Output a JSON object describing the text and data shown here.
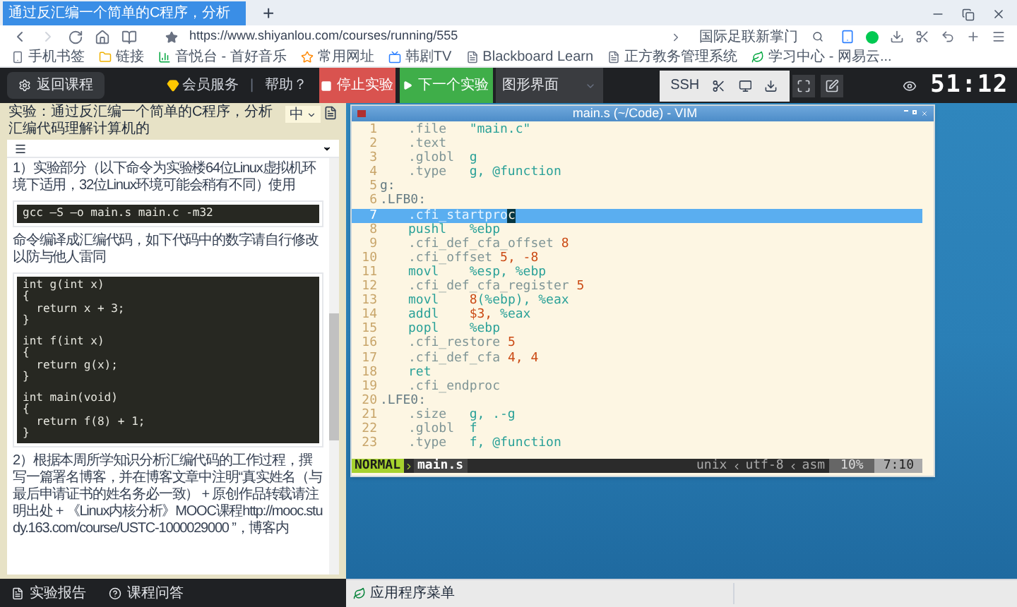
{
  "browser": {
    "tab": {
      "title": "通过反汇编一个简单的C程序，分析",
      "selected": true
    },
    "new_tab": "+",
    "url": "https://www.shiyanlou.com/courses/running/555",
    "search": {
      "value": "国际足联新掌门"
    },
    "bookmarks": [
      {
        "label": "手机书签",
        "kind": "phone"
      },
      {
        "label": "链接",
        "kind": "folder"
      },
      {
        "label": "音悦台 - 首好音乐",
        "kind": "chart"
      },
      {
        "label": "常用网址",
        "kind": "star"
      },
      {
        "label": "韩剧TV",
        "kind": "tv"
      },
      {
        "label": "Blackboard Learn",
        "kind": "page"
      },
      {
        "label": "正方教务管理系统",
        "kind": "page"
      },
      {
        "label": "学习中心 - 网易云...",
        "kind": "leaf"
      }
    ]
  },
  "toolbar": {
    "back": "返回课程",
    "member": "会员服务",
    "separator": "|",
    "help": "帮助？",
    "stop": "停止实验",
    "next": "下一个实验",
    "view_select": "图形界面",
    "ssh": "SSH",
    "timer": "51:12"
  },
  "lab": {
    "title": "实验：通过反汇编一个简单的C程序，分析汇编代码理解计算机的",
    "language": "中",
    "content": [
      {
        "kind": "text",
        "text": "1）实验部分（以下命令为实验楼64位Linux虚拟机环境下适用，32位Linux环境可能会稍有不同）使用"
      },
      {
        "kind": "code",
        "blocks": [
          [
            "gcc –S –o main.s main.c -m32"
          ]
        ]
      },
      {
        "kind": "text",
        "text": "命令编译成汇编代码，如下代码中的数字请自行修改以防与他人雷同"
      },
      {
        "kind": "code",
        "blocks": [
          [
            "int g(int x)",
            "{",
            "  return x + 3;",
            "}"
          ],
          [
            "int f(int x)",
            "{",
            "  return g(x);",
            "}"
          ],
          [
            "int main(void)",
            "{",
            "  return f(8) + 1;",
            "}"
          ]
        ]
      },
      {
        "kind": "text",
        "text": "2）根据本周所学知识分析汇编代码的工作过程，撰写一篇署名博客，并在博客文章中注明“真实姓名（与最后申请证书的姓名务必一致） + 原创作品转载请注明出处 + 《Linux内核分析》MOOC课程http://mooc.study.163.com/course/USTC-1000029000 ”，博客内"
      }
    ],
    "footer": [
      {
        "label": "实验报告",
        "kind": "report"
      },
      {
        "label": "课程问答",
        "kind": "question"
      }
    ]
  },
  "vim": {
    "title": "main.s (~/Code) - VIM",
    "lines": [
      {
        "number": "1",
        "indented": true,
        "selected": false,
        "tokens": [
          {
            "text": ".file",
            "kind": "dir"
          },
          {
            "text": "\"main.c\"",
            "kind": "str"
          }
        ]
      },
      {
        "number": "2",
        "indented": true,
        "selected": false,
        "tokens": [
          {
            "text": ".text",
            "kind": "dir"
          }
        ]
      },
      {
        "number": "3",
        "indented": true,
        "selected": false,
        "tokens": [
          {
            "text": ".globl",
            "kind": "dir"
          },
          {
            "text": "g",
            "kind": "op"
          }
        ]
      },
      {
        "number": "4",
        "indented": true,
        "selected": false,
        "tokens": [
          {
            "text": ".type",
            "kind": "dir"
          },
          {
            "text": "g, @function",
            "kind": "op"
          }
        ]
      },
      {
        "number": "5",
        "indented": false,
        "selected": false,
        "tokens": [
          {
            "text": "g:",
            "kind": "lbl"
          }
        ]
      },
      {
        "number": "6",
        "indented": false,
        "selected": false,
        "tokens": [
          {
            "text": ".LFB0:",
            "kind": "lbl"
          }
        ]
      },
      {
        "number": "7",
        "indented": true,
        "selected": true,
        "tokens": [
          {
            "text": ".cfi_startpro",
            "kind": "dir"
          },
          {
            "text": "c",
            "kind": "cursor"
          }
        ]
      },
      {
        "number": "8",
        "indented": true,
        "selected": false,
        "tokens": [
          {
            "text": "pushl",
            "kind": "instr"
          },
          {
            "text": "%ebp",
            "kind": "op"
          }
        ]
      },
      {
        "number": "9",
        "indented": true,
        "selected": false,
        "tokens": [
          {
            "text": ".cfi_def_cfa_offset",
            "kind": "dir"
          },
          {
            "text": "8",
            "kind": "num"
          }
        ]
      },
      {
        "number": "10",
        "indented": true,
        "selected": false,
        "tokens": [
          {
            "text": ".cfi_offset",
            "kind": "dir"
          },
          {
            "text": "5, -8",
            "kind": "num"
          }
        ]
      },
      {
        "number": "11",
        "indented": true,
        "selected": false,
        "tokens": [
          {
            "text": "movl",
            "kind": "instr"
          },
          {
            "text": "%esp, %ebp",
            "kind": "op"
          }
        ]
      },
      {
        "number": "12",
        "indented": true,
        "selected": false,
        "tokens": [
          {
            "text": ".cfi_def_cfa_register",
            "kind": "dir"
          },
          {
            "text": "5",
            "kind": "num"
          }
        ]
      },
      {
        "number": "13",
        "indented": true,
        "selected": false,
        "tokens": [
          {
            "text": "movl",
            "kind": "instr"
          },
          {
            "text": "8",
            "kind": "num"
          },
          {
            "text": "(%ebp), %eax",
            "kind": "op"
          }
        ]
      },
      {
        "number": "14",
        "indented": true,
        "selected": false,
        "tokens": [
          {
            "text": "addl",
            "kind": "instr"
          },
          {
            "text": "$3,",
            "kind": "num"
          },
          {
            "text": "%eax",
            "kind": "op"
          }
        ]
      },
      {
        "number": "15",
        "indented": true,
        "selected": false,
        "tokens": [
          {
            "text": "popl",
            "kind": "instr"
          },
          {
            "text": "%ebp",
            "kind": "op"
          }
        ]
      },
      {
        "number": "16",
        "indented": true,
        "selected": false,
        "tokens": [
          {
            "text": ".cfi_restore",
            "kind": "dir"
          },
          {
            "text": "5",
            "kind": "num"
          }
        ]
      },
      {
        "number": "17",
        "indented": true,
        "selected": false,
        "tokens": [
          {
            "text": ".cfi_def_cfa",
            "kind": "dir"
          },
          {
            "text": "4, 4",
            "kind": "num"
          }
        ]
      },
      {
        "number": "18",
        "indented": true,
        "selected": false,
        "tokens": [
          {
            "text": "ret",
            "kind": "instr"
          }
        ]
      },
      {
        "number": "19",
        "indented": true,
        "selected": false,
        "tokens": [
          {
            "text": ".cfi_endproc",
            "kind": "dir"
          }
        ]
      },
      {
        "number": "20",
        "indented": false,
        "selected": false,
        "tokens": [
          {
            "text": ".LFE0:",
            "kind": "lbl"
          }
        ]
      },
      {
        "number": "21",
        "indented": true,
        "selected": false,
        "tokens": [
          {
            "text": ".size",
            "kind": "dir"
          },
          {
            "text": "g, .-g",
            "kind": "op"
          }
        ]
      },
      {
        "number": "22",
        "indented": true,
        "selected": false,
        "tokens": [
          {
            "text": ".globl",
            "kind": "dir"
          },
          {
            "text": "f",
            "kind": "op"
          }
        ]
      },
      {
        "number": "23",
        "indented": true,
        "selected": false,
        "tokens": [
          {
            "text": ".type",
            "kind": "dir"
          },
          {
            "text": "f, @function",
            "kind": "op"
          }
        ]
      }
    ],
    "status": {
      "mode": "NORMAL",
      "file": "main.s",
      "segments": [
        "unix",
        "utf-8",
        "asm"
      ],
      "percent": "10%",
      "position": "7:10"
    }
  },
  "taskbar": {
    "menu": "应用程序菜单"
  }
}
